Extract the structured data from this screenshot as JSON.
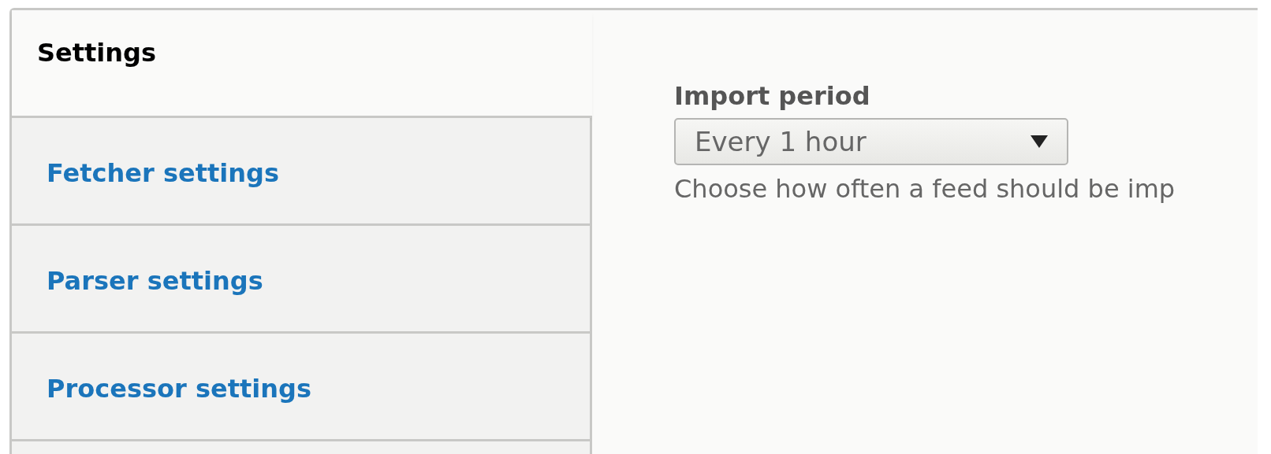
{
  "tabs": [
    {
      "label": "Settings",
      "selected": true
    },
    {
      "label": "Fetcher settings",
      "selected": false
    },
    {
      "label": "Parser settings",
      "selected": false
    },
    {
      "label": "Processor settings",
      "selected": false
    }
  ],
  "field": {
    "label": "Import period",
    "value": "Every 1 hour",
    "description": "Choose how often a feed should be imp"
  }
}
